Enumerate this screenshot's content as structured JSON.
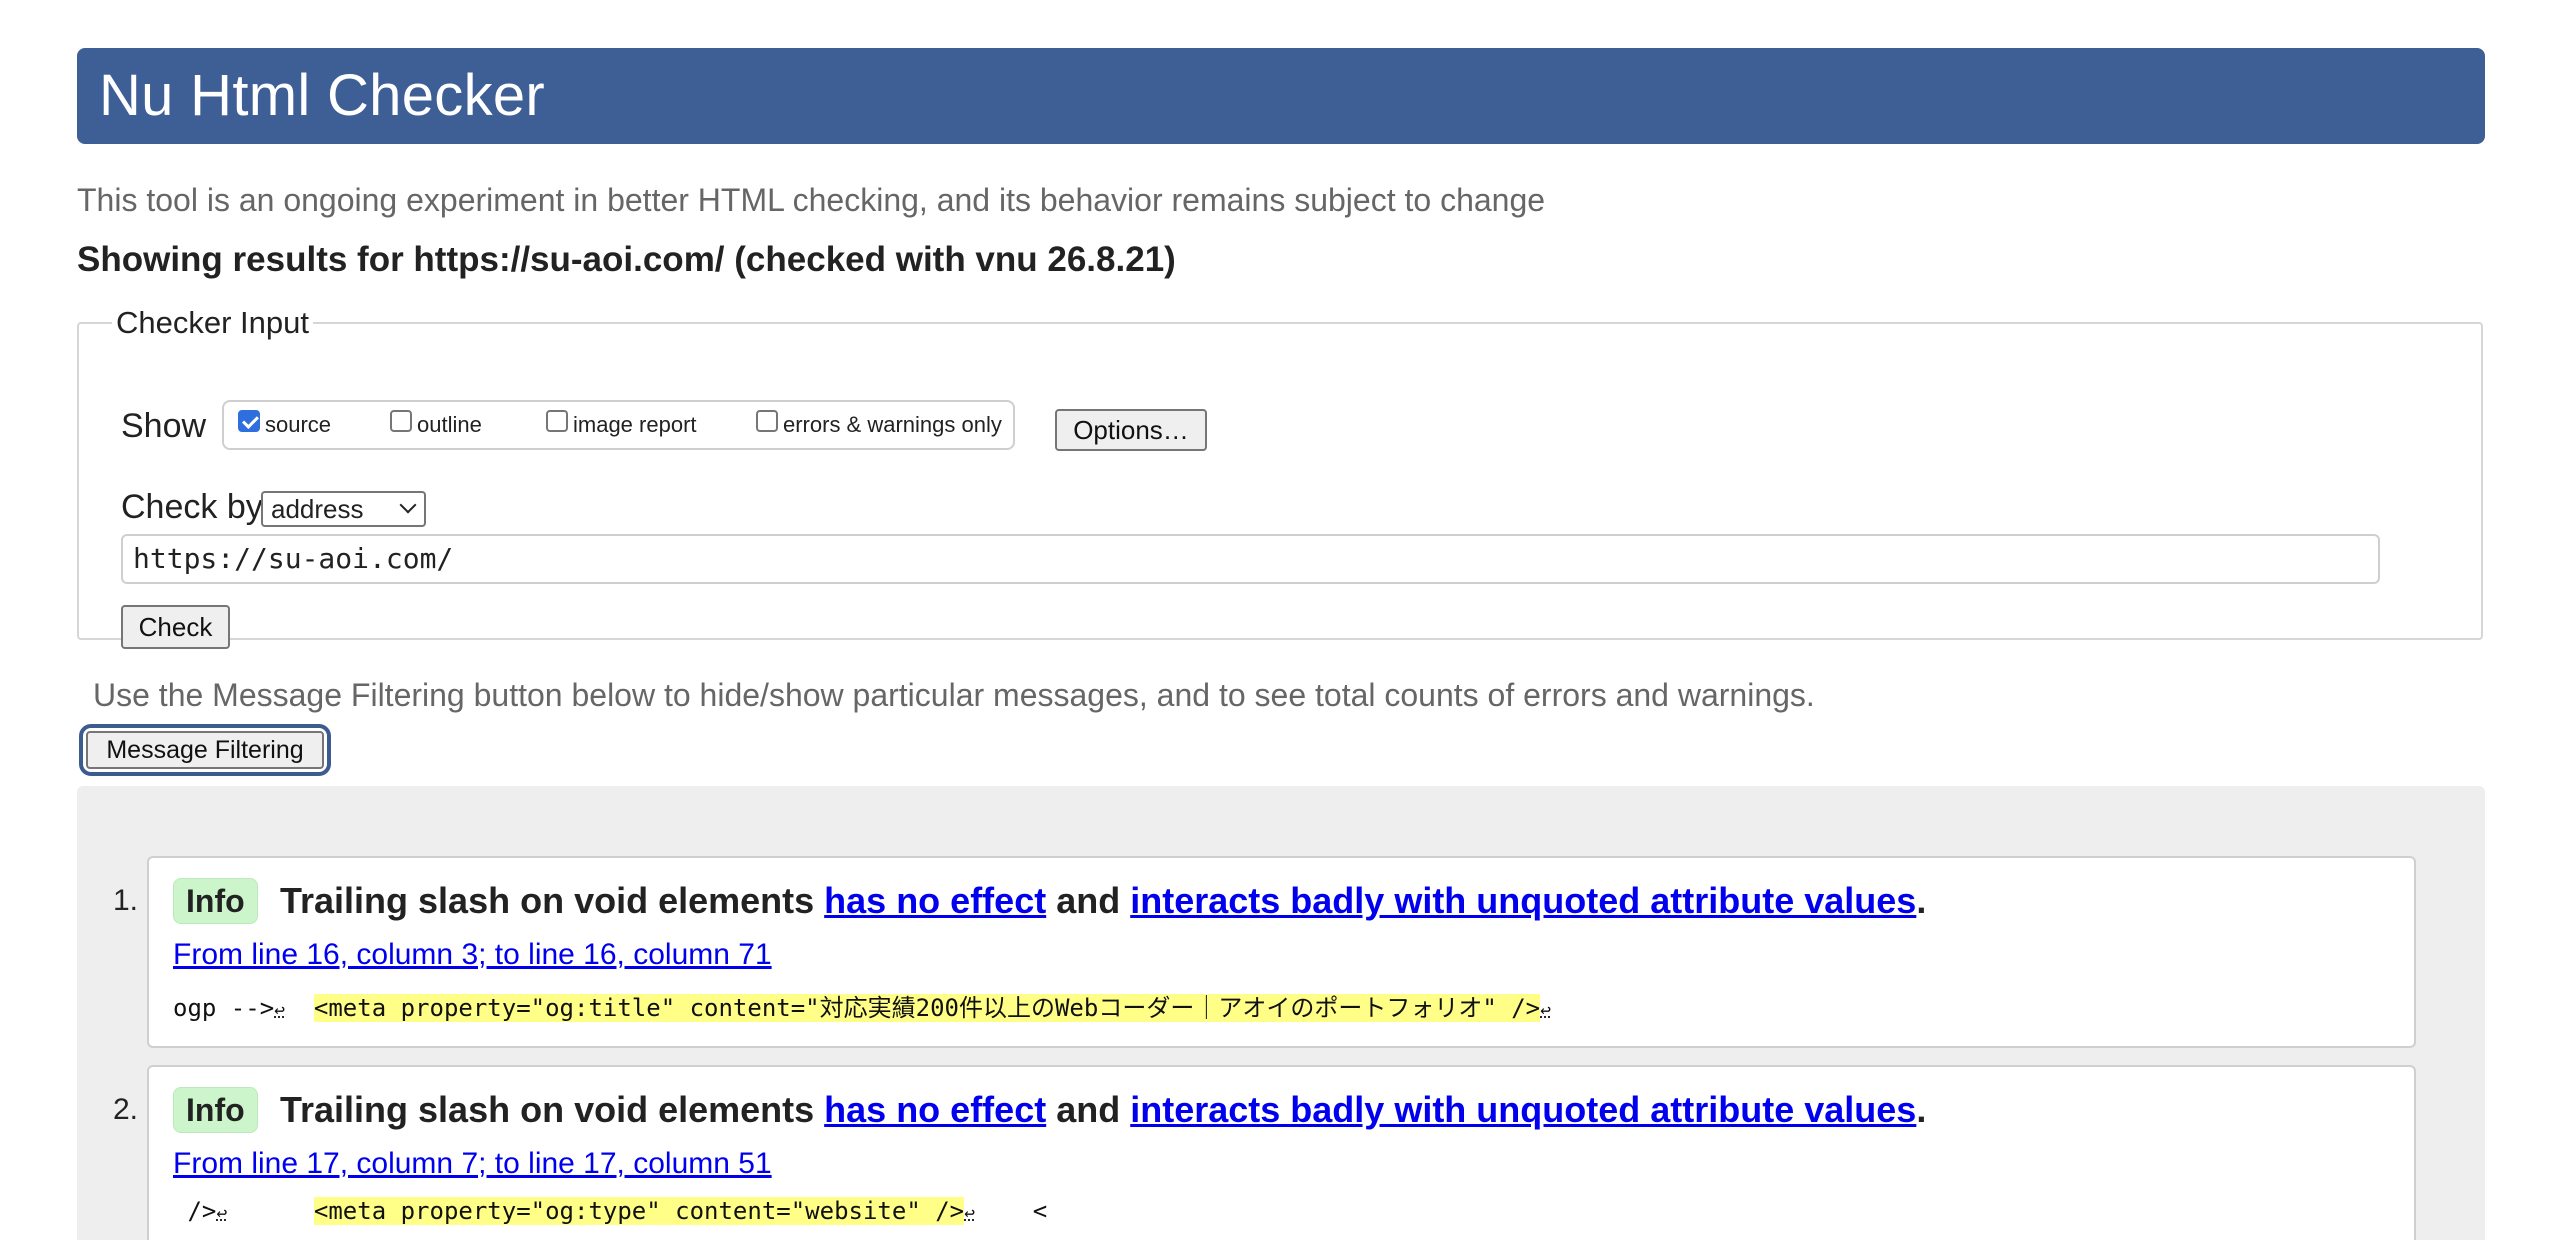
{
  "header": {
    "title": "Nu Html Checker"
  },
  "tagline": "This tool is an ongoing experiment in better HTML checking, and its behavior remains subject to change",
  "results_for": "Showing results for https://su-aoi.com/ (checked with vnu 26.8.21)",
  "checker_input": {
    "legend": "Checker Input",
    "show_label": "Show",
    "options": [
      {
        "label": "source",
        "checked": true
      },
      {
        "label": "outline",
        "checked": false
      },
      {
        "label": "image report",
        "checked": false
      },
      {
        "label": "errors & warnings only",
        "checked": false
      }
    ],
    "options_button": "Options…",
    "check_by_label": "Check by",
    "check_by_value": "address",
    "url_value": "https://su-aoi.com/",
    "check_button": "Check"
  },
  "filter_hint": "Use the Message Filtering button below to hide/show particular messages, and to see total counts of errors and warnings.",
  "filter_button": "Message Filtering",
  "messages": [
    {
      "number": "1.",
      "type": "Info",
      "text_before": "Trailing slash on void elements ",
      "link1": "has no effect",
      "text_mid": " and ",
      "link2": "interacts badly with unquoted attribute values",
      "text_after": ".",
      "location": "From line 16, column 3; to line 16, column 71",
      "src_pre": "ogp -->",
      "src_pre_ret": "↩",
      "src_gap": "  ",
      "src_highlight": "<meta property=\"og:title\" content=\"対応実績200件以上のWebコーダー｜アオイのポートフォリオ\" />",
      "src_post_ret": "↩",
      "src_post": ""
    },
    {
      "number": "2.",
      "type": "Info",
      "text_before": "Trailing slash on void elements ",
      "link1": "has no effect",
      "text_mid": " and ",
      "link2": "interacts badly with unquoted attribute values",
      "text_after": ".",
      "location": "From line 17, column 7; to line 17, column 51",
      "src_pre": " />",
      "src_pre_ret": "↩",
      "src_gap": "      ",
      "src_highlight": "<meta property=\"og:type\" content=\"website\" />",
      "src_post_ret": "↩",
      "src_post": "    <"
    }
  ],
  "colors": {
    "header_bg": "#3e5e96",
    "info_badge": "#ccf5cc",
    "highlight": "#ffff88",
    "link": "#0000ee"
  }
}
